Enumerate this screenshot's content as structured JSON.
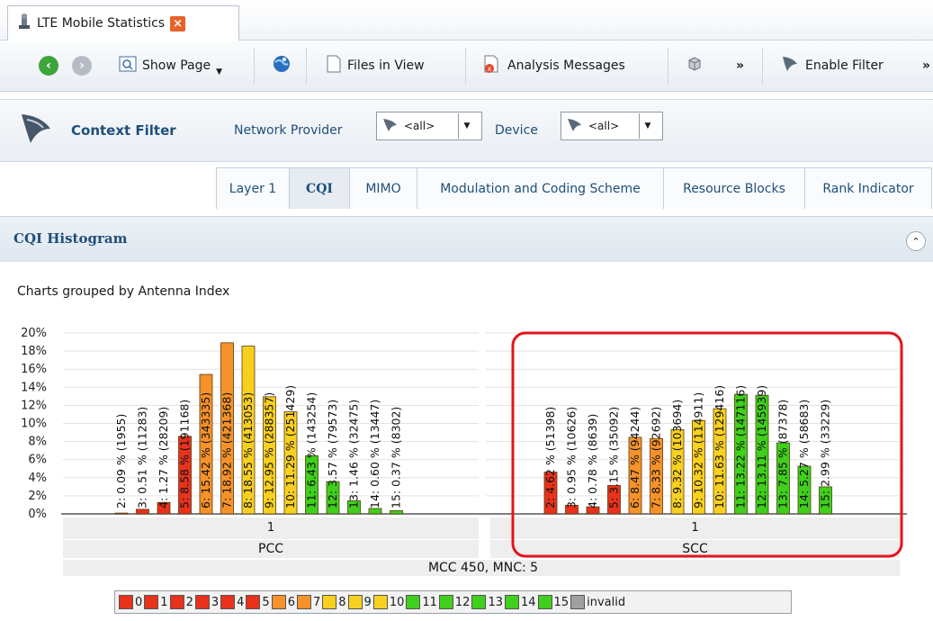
{
  "tab": {
    "title": "LTE Mobile Statistics",
    "close": "×"
  },
  "toolbar": {
    "show_page": "Show Page",
    "files_in_view": "Files in View",
    "analysis_messages": "Analysis Messages",
    "more": "»",
    "enable_filter": "Enable Filter",
    "more2": "»"
  },
  "context": {
    "title": "Context Filter",
    "network_provider_label": "Network Provider",
    "network_provider_value": "<all>",
    "device_label": "Device",
    "device_value": "<all>"
  },
  "subtabs": [
    "Layer 1",
    "CQI",
    "MIMO",
    "Modulation and Coding Scheme",
    "Resource Blocks",
    "Rank Indicator"
  ],
  "active_subtab": "CQI",
  "panel": {
    "title": "CQI Histogram",
    "subtitle": "Charts grouped by Antenna Index"
  },
  "colors": {
    "red": "#e8321c",
    "orange": "#f5922a",
    "yellow": "#f8d020",
    "green": "#3fcf1c",
    "gray": "#a0a0a0"
  },
  "chart_data": {
    "type": "bar",
    "ylim": [
      0,
      20
    ],
    "yticks": [
      "0%",
      "2%",
      "4%",
      "6%",
      "8%",
      "10%",
      "12%",
      "14%",
      "16%",
      "18%",
      "20%"
    ],
    "grid": true,
    "groups": [
      {
        "antenna": "1",
        "name": "PCC",
        "bars": [
          {
            "cqi": 2,
            "value": 0.09,
            "count": 1955,
            "label": "2: 0.09 % (1955)"
          },
          {
            "cqi": 3,
            "value": 0.51,
            "count": 11283,
            "label": "3: 0.51 % (11283)"
          },
          {
            "cqi": 4,
            "value": 1.27,
            "count": 28209,
            "label": "4: 1.27 % (28209)"
          },
          {
            "cqi": 5,
            "value": 8.58,
            "count": 191168,
            "label": "5: 8.58 % (191168)"
          },
          {
            "cqi": 6,
            "value": 15.42,
            "count": 343335,
            "label": "6: 15.42 % (343335)"
          },
          {
            "cqi": 7,
            "value": 18.92,
            "count": 421368,
            "label": "7: 18.92 % (421368)"
          },
          {
            "cqi": 8,
            "value": 18.55,
            "count": 413053,
            "label": "8: 18.55 % (413053)"
          },
          {
            "cqi": 9,
            "value": 12.95,
            "count": 288357,
            "label": "9: 12.95 % (288357)"
          },
          {
            "cqi": 10,
            "value": 11.29,
            "count": 251429,
            "label": "10: 11.29 % (251429)"
          },
          {
            "cqi": 11,
            "value": 6.43,
            "count": 143254,
            "label": "11: 6.43 % (143254)"
          },
          {
            "cqi": 12,
            "value": 3.57,
            "count": 79573,
            "label": "12: 3.57 % (79573)"
          },
          {
            "cqi": 13,
            "value": 1.46,
            "count": 32475,
            "label": "13: 1.46 % (32475)"
          },
          {
            "cqi": 14,
            "value": 0.6,
            "count": 13447,
            "label": "14: 0.60 % (13447)"
          },
          {
            "cqi": 15,
            "value": 0.37,
            "count": 8302,
            "label": "15: 0.37 % (8302)"
          }
        ]
      },
      {
        "antenna": "1",
        "name": "SCC",
        "bars": [
          {
            "cqi": 2,
            "value": 4.62,
            "count": 51398,
            "label": "2: 4.62 % (51398)"
          },
          {
            "cqi": 3,
            "value": 0.95,
            "count": 10626,
            "label": "3: 0.95 % (10626)"
          },
          {
            "cqi": 4,
            "value": 0.78,
            "count": 8639,
            "label": "4: 0.78 % (8639)"
          },
          {
            "cqi": 5,
            "value": 3.15,
            "count": 35092,
            "label": "5: 3.15 % (35092)"
          },
          {
            "cqi": 6,
            "value": 8.47,
            "count": 94244,
            "label": "6: 8.47 % (94244)"
          },
          {
            "cqi": 7,
            "value": 8.33,
            "count": 92692,
            "label": "7: 8.33 % (92692)"
          },
          {
            "cqi": 8,
            "value": 9.32,
            "count": 103694,
            "label": "8: 9.32 % (103694)"
          },
          {
            "cqi": 9,
            "value": 10.32,
            "count": 114911,
            "label": "9: 10.32 % (114911)"
          },
          {
            "cqi": 10,
            "value": 11.63,
            "count": 129416,
            "label": "10: 11.63 % (129416)"
          },
          {
            "cqi": 11,
            "value": 13.22,
            "count": 147116,
            "label": "11: 13.22 % (147116)"
          },
          {
            "cqi": 12,
            "value": 13.11,
            "count": 145939,
            "label": "12: 13.11 % (145939)"
          },
          {
            "cqi": 13,
            "value": 7.85,
            "count": 87378,
            "label": "13: 7.85 % (87378)"
          },
          {
            "cqi": 14,
            "value": 5.27,
            "count": 58683,
            "label": "14: 5.27 % (58683)"
          },
          {
            "cqi": 15,
            "value": 2.99,
            "count": 33229,
            "label": "15: 2.99 % (33229)"
          }
        ]
      }
    ],
    "footer": "MCC 450, MNC: 5",
    "legend": [
      "0",
      "1",
      "2",
      "3",
      "4",
      "5",
      "6",
      "7",
      "8",
      "9",
      "10",
      "11",
      "12",
      "13",
      "14",
      "15",
      "invalid"
    ],
    "highlight_group": "SCC"
  }
}
